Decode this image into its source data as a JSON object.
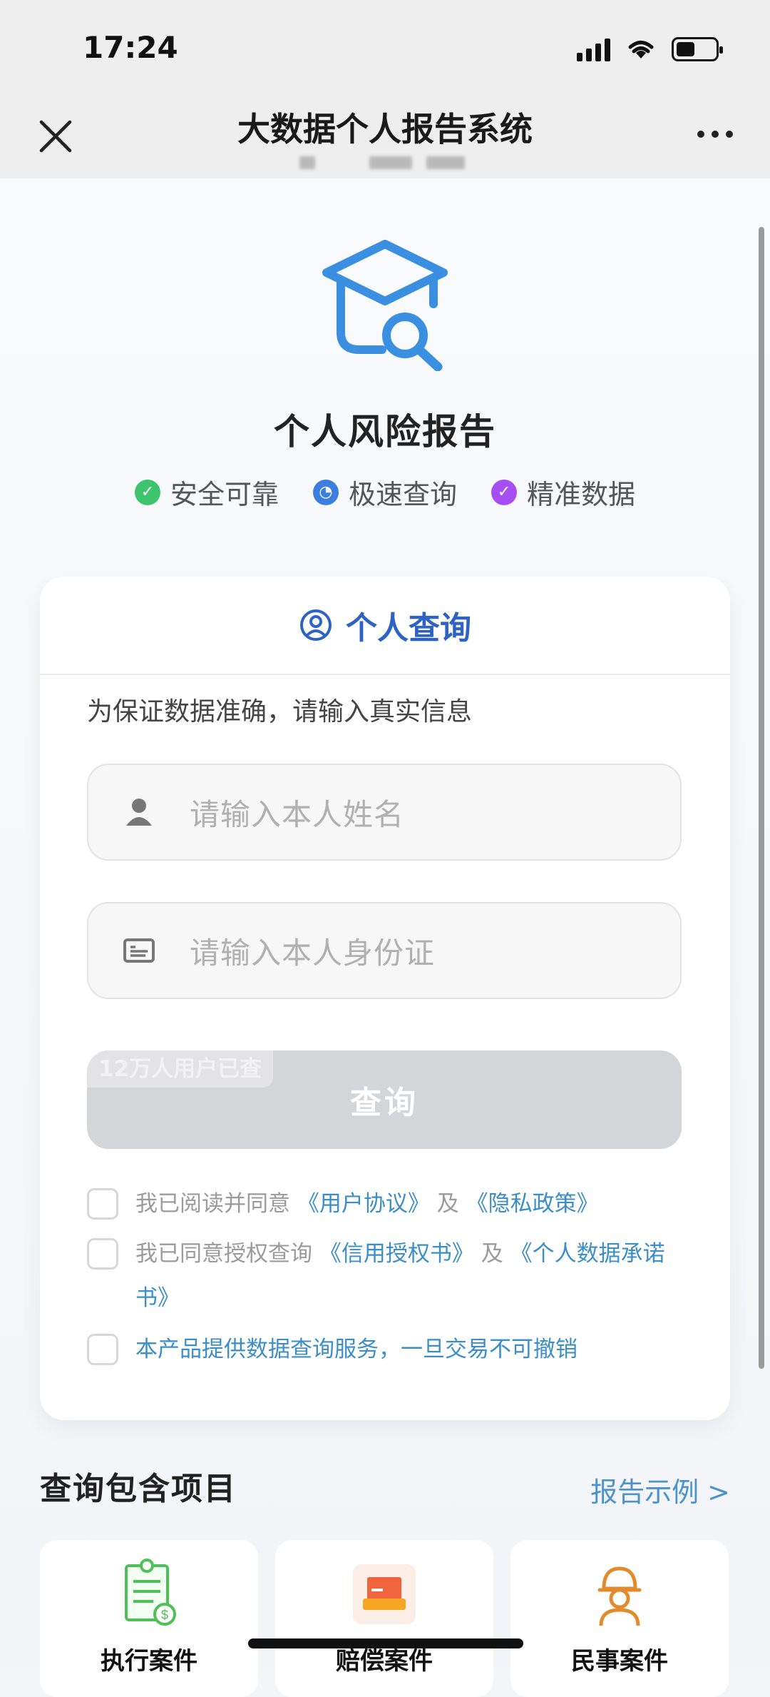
{
  "status_bar": {
    "time": "17:24"
  },
  "nav": {
    "title": "大数据个人报告系统"
  },
  "hero": {
    "title": "个人风险报告",
    "features": [
      {
        "icon": "check-circle-icon",
        "label": "安全可靠",
        "color": "#3ec46d"
      },
      {
        "icon": "clock-icon",
        "label": "极速查询",
        "color": "#3d7fe0"
      },
      {
        "icon": "verified-icon",
        "label": "精准数据",
        "color": "#a64ef4"
      }
    ]
  },
  "card": {
    "title": "个人查询",
    "tip": "为保证数据准确，请输入真实信息",
    "name_placeholder": "请输入本人姓名",
    "id_placeholder": "请输入本人身份证",
    "badge": "12万人用户已查",
    "query_label": "查询",
    "agreements": [
      {
        "prefix": "我已阅读并同意",
        "link1": "《用户协议》",
        "mid": "及",
        "link2": "《隐私政策》"
      },
      {
        "prefix": "我已同意授权查询",
        "link1": "《信用授权书》",
        "mid": "及",
        "link2": "《个人数据承诺书》"
      },
      {
        "notice": "本产品提供数据查询服务，一旦交易不可撤销"
      }
    ]
  },
  "section": {
    "title": "查询包含项目",
    "link": "报告示例 >",
    "items": [
      {
        "label": "执行案件",
        "icon": "document-list-icon"
      },
      {
        "label": "赔偿案件",
        "icon": "compensation-icon"
      },
      {
        "label": "民事案件",
        "icon": "worker-icon"
      }
    ]
  }
}
